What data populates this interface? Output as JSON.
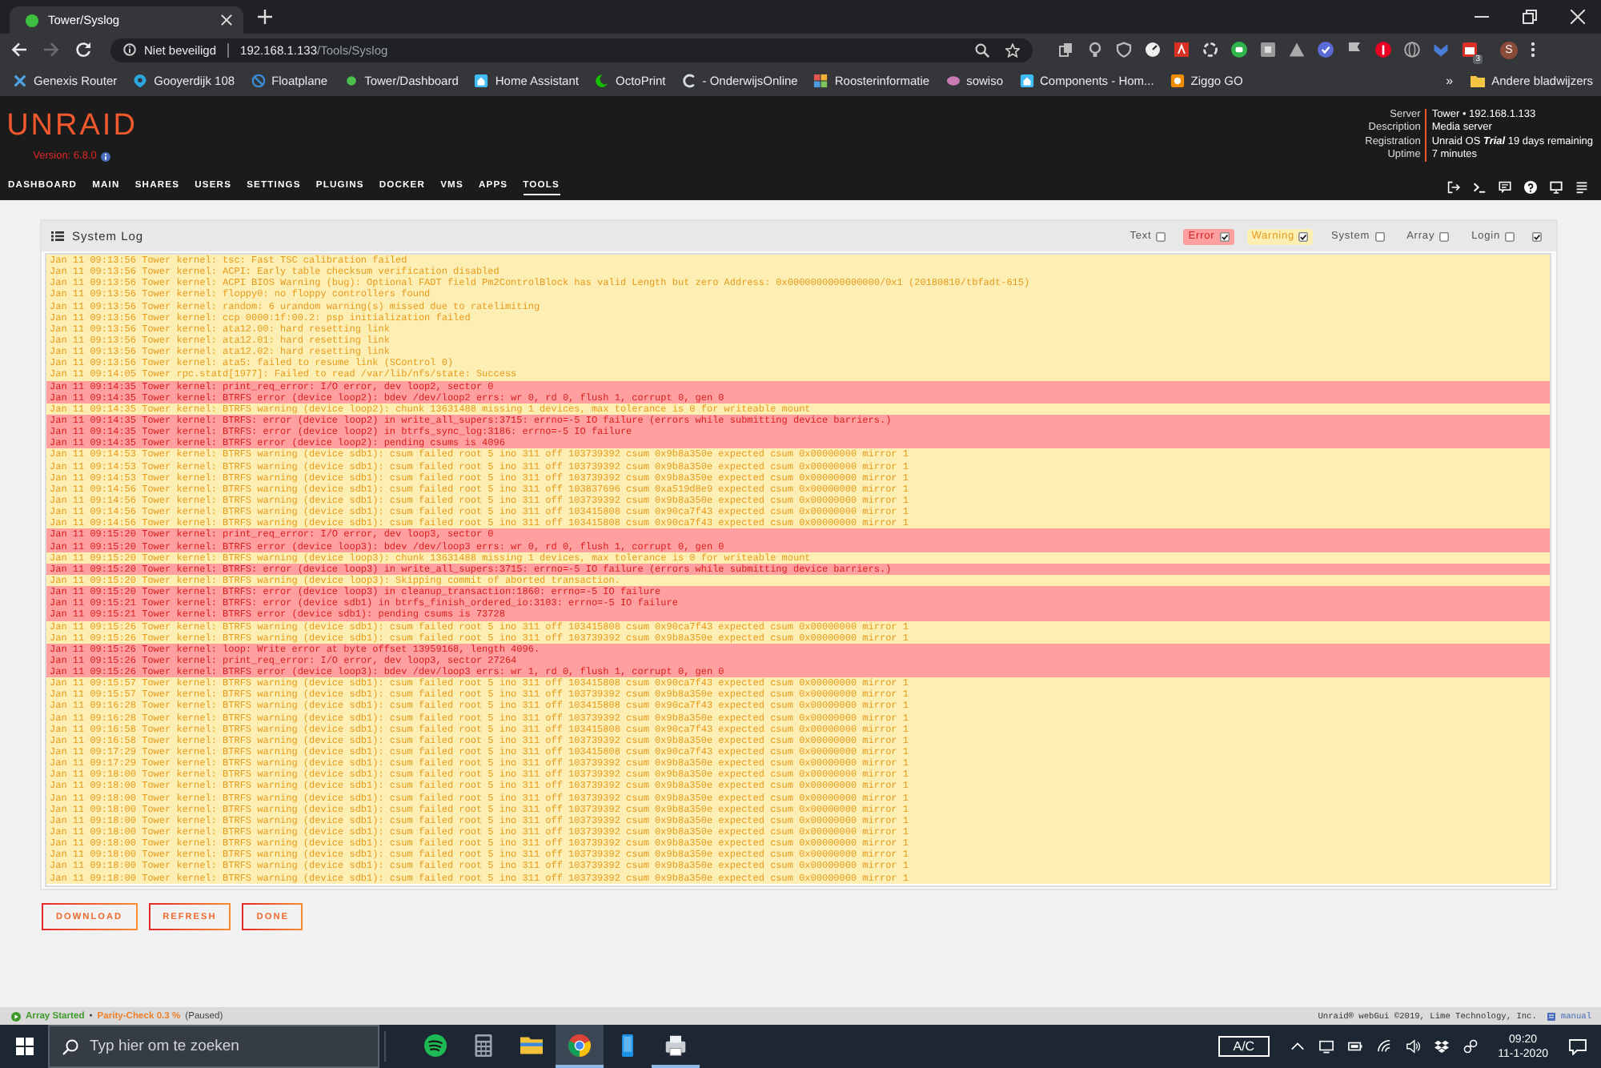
{
  "browser": {
    "tab_title": "Tower/Syslog",
    "nav": [
      {
        "kind": "back",
        "disabled": false
      },
      {
        "kind": "forward",
        "disabled": true
      },
      {
        "kind": "reload",
        "disabled": false
      }
    ],
    "address": {
      "security": "Niet beveiligd",
      "host": "192.168.1.133",
      "path": "/Tools/Syslog"
    },
    "extension_badge": "3",
    "profile_initial": "S",
    "bookmarks": [
      "Genexis Router",
      "Gooyerdijk 108",
      "Floatplane",
      "Tower/Dashboard",
      "Home Assistant",
      "OctoPrint",
      "- OnderwijsOnline",
      "Roosterinformatie",
      "sowiso",
      "Components - Hom...",
      "Ziggo GO"
    ],
    "bookmarks_overflow": "»",
    "other_bookmarks": "Andere bladwijzers"
  },
  "unraid": {
    "logo": "UNRAID",
    "version": "Version: 6.8.0",
    "server_info": [
      {
        "label": "Server",
        "value": "Tower • 192.168.1.133"
      },
      {
        "label": "Description",
        "value": "Media server"
      },
      {
        "label": "Registration",
        "value": "Unraid OS **Trial** 19 days remaining"
      },
      {
        "label": "Uptime",
        "value": "7 minutes"
      }
    ],
    "nav": [
      {
        "label": "DASHBOARD",
        "selected": false
      },
      {
        "label": "MAIN",
        "selected": false
      },
      {
        "label": "SHARES",
        "selected": false
      },
      {
        "label": "USERS",
        "selected": false
      },
      {
        "label": "SETTINGS",
        "selected": false
      },
      {
        "label": "PLUGINS",
        "selected": false
      },
      {
        "label": "DOCKER",
        "selected": false
      },
      {
        "label": "VMS",
        "selected": false
      },
      {
        "label": "APPS",
        "selected": false
      },
      {
        "label": "TOOLS",
        "selected": true
      }
    ]
  },
  "syslog": {
    "title": "System Log",
    "filters": [
      {
        "label": "Text",
        "checked": false
      },
      {
        "label": "Error",
        "checked": true,
        "color": "#ff9f9f"
      },
      {
        "label": "Warning",
        "checked": true,
        "color": "#fdefb3"
      },
      {
        "label": "System",
        "checked": false
      },
      {
        "label": "Array",
        "checked": false
      },
      {
        "label": "Login",
        "checked": false
      },
      {
        "checked": true
      }
    ],
    "lines": [
      {
        "kind": "warning",
        "text": "Jan 11 09:13:56 Tower kernel: tsc: Fast TSC calibration failed"
      },
      {
        "kind": "warning",
        "text": "Jan 11 09:13:56 Tower kernel: ACPI: Early table checksum verification disabled"
      },
      {
        "kind": "warning",
        "text": "Jan 11 09:13:56 Tower kernel: ACPI BIOS Warning (bug): Optional FADT field Pm2ControlBlock has valid Length but zero Address: 0x0000000000000000/0x1 (20180810/tbfadt-615)"
      },
      {
        "kind": "warning",
        "text": "Jan 11 09:13:56 Tower kernel: floppy0: no floppy controllers found"
      },
      {
        "kind": "warning",
        "text": "Jan 11 09:13:56 Tower kernel: random: 6 urandom warning(s) missed due to ratelimiting"
      },
      {
        "kind": "warning",
        "text": "Jan 11 09:13:56 Tower kernel: ccp 0000:1f:00.2: psp initialization failed"
      },
      {
        "kind": "warning",
        "text": "Jan 11 09:13:56 Tower kernel: ata12.00: hard resetting link"
      },
      {
        "kind": "warning",
        "text": "Jan 11 09:13:56 Tower kernel: ata12.01: hard resetting link"
      },
      {
        "kind": "warning",
        "text": "Jan 11 09:13:56 Tower kernel: ata12.02: hard resetting link"
      },
      {
        "kind": "warning",
        "text": "Jan 11 09:13:56 Tower kernel: ata5: failed to resume link (SControl 0)"
      },
      {
        "kind": "warning",
        "text": "Jan 11 09:14:05 Tower rpc.statd[1977]: Failed to read /var/lib/nfs/state: Success"
      },
      {
        "kind": "error",
        "text": "Jan 11 09:14:35 Tower kernel: print_req_error: I/O error, dev loop2, sector 0"
      },
      {
        "kind": "error",
        "text": "Jan 11 09:14:35 Tower kernel: BTRFS error (device loop2): bdev /dev/loop2 errs: wr 0, rd 0, flush 1, corrupt 0, gen 0"
      },
      {
        "kind": "warning",
        "text": "Jan 11 09:14:35 Tower kernel: BTRFS warning (device loop2): chunk 13631488 missing 1 devices, max tolerance is 0 for writeable mount"
      },
      {
        "kind": "error",
        "text": "Jan 11 09:14:35 Tower kernel: BTRFS: error (device loop2) in write_all_supers:3715: errno=-5 IO failure (errors while submitting device barriers.)"
      },
      {
        "kind": "error",
        "text": "Jan 11 09:14:35 Tower kernel: BTRFS: error (device loop2) in btrfs_sync_log:3186: errno=-5 IO failure"
      },
      {
        "kind": "error",
        "text": "Jan 11 09:14:35 Tower kernel: BTRFS error (device loop2): pending csums is 4096"
      },
      {
        "kind": "warning",
        "text": "Jan 11 09:14:53 Tower kernel: BTRFS warning (device sdb1): csum failed root 5 ino 311 off 103739392 csum 0x9b8a350e expected csum 0x00000000 mirror 1"
      },
      {
        "kind": "warning",
        "text": "Jan 11 09:14:53 Tower kernel: BTRFS warning (device sdb1): csum failed root 5 ino 311 off 103739392 csum 0x9b8a350e expected csum 0x00000000 mirror 1"
      },
      {
        "kind": "warning",
        "text": "Jan 11 09:14:53 Tower kernel: BTRFS warning (device sdb1): csum failed root 5 ino 311 off 103739392 csum 0x9b8a350e expected csum 0x00000000 mirror 1"
      },
      {
        "kind": "warning",
        "text": "Jan 11 09:14:56 Tower kernel: BTRFS warning (device sdb1): csum failed root 5 ino 311 off 103837696 csum 0xa519d8e9 expected csum 0x00000000 mirror 1"
      },
      {
        "kind": "warning",
        "text": "Jan 11 09:14:56 Tower kernel: BTRFS warning (device sdb1): csum failed root 5 ino 311 off 103739392 csum 0x9b8a350e expected csum 0x00000000 mirror 1"
      },
      {
        "kind": "warning",
        "text": "Jan 11 09:14:56 Tower kernel: BTRFS warning (device sdb1): csum failed root 5 ino 311 off 103415808 csum 0x90ca7f43 expected csum 0x00000000 mirror 1"
      },
      {
        "kind": "warning",
        "text": "Jan 11 09:14:56 Tower kernel: BTRFS warning (device sdb1): csum failed root 5 ino 311 off 103415808 csum 0x90ca7f43 expected csum 0x00000000 mirror 1"
      },
      {
        "kind": "error",
        "text": "Jan 11 09:15:20 Tower kernel: print_req_error: I/O error, dev loop3, sector 0"
      },
      {
        "kind": "error",
        "text": "Jan 11 09:15:20 Tower kernel: BTRFS error (device loop3): bdev /dev/loop3 errs: wr 0, rd 0, flush 1, corrupt 0, gen 0"
      },
      {
        "kind": "warning",
        "text": "Jan 11 09:15:20 Tower kernel: BTRFS warning (device loop3): chunk 13631488 missing 1 devices, max tolerance is 0 for writeable mount"
      },
      {
        "kind": "error",
        "text": "Jan 11 09:15:20 Tower kernel: BTRFS: error (device loop3) in write_all_supers:3715: errno=-5 IO failure (errors while submitting device barriers.)"
      },
      {
        "kind": "warning",
        "text": "Jan 11 09:15:20 Tower kernel: BTRFS warning (device loop3): Skipping commit of aborted transaction."
      },
      {
        "kind": "error",
        "text": "Jan 11 09:15:20 Tower kernel: BTRFS: error (device loop3) in cleanup_transaction:1860: errno=-5 IO failure"
      },
      {
        "kind": "error",
        "text": "Jan 11 09:15:21 Tower kernel: BTRFS: error (device sdb1) in btrfs_finish_ordered_io:3103: errno=-5 IO failure"
      },
      {
        "kind": "error",
        "text": "Jan 11 09:15:21 Tower kernel: BTRFS error (device sdb1): pending csums is 73728"
      },
      {
        "kind": "warning",
        "text": "Jan 11 09:15:26 Tower kernel: BTRFS warning (device sdb1): csum failed root 5 ino 311 off 103415808 csum 0x90ca7f43 expected csum 0x00000000 mirror 1"
      },
      {
        "kind": "warning",
        "text": "Jan 11 09:15:26 Tower kernel: BTRFS warning (device sdb1): csum failed root 5 ino 311 off 103739392 csum 0x9b8a350e expected csum 0x00000000 mirror 1"
      },
      {
        "kind": "error",
        "text": "Jan 11 09:15:26 Tower kernel: loop: Write error at byte offset 13959168, length 4096."
      },
      {
        "kind": "error",
        "text": "Jan 11 09:15:26 Tower kernel: print_req_error: I/O error, dev loop3, sector 27264"
      },
      {
        "kind": "error",
        "text": "Jan 11 09:15:26 Tower kernel: BTRFS error (device loop3): bdev /dev/loop3 errs: wr 1, rd 0, flush 1, corrupt 0, gen 0"
      },
      {
        "kind": "warning",
        "text": "Jan 11 09:15:57 Tower kernel: BTRFS warning (device sdb1): csum failed root 5 ino 311 off 103415808 csum 0x90ca7f43 expected csum 0x00000000 mirror 1"
      },
      {
        "kind": "warning",
        "text": "Jan 11 09:15:57 Tower kernel: BTRFS warning (device sdb1): csum failed root 5 ino 311 off 103739392 csum 0x9b8a350e expected csum 0x00000000 mirror 1"
      },
      {
        "kind": "warning",
        "text": "Jan 11 09:16:28 Tower kernel: BTRFS warning (device sdb1): csum failed root 5 ino 311 off 103415808 csum 0x90ca7f43 expected csum 0x00000000 mirror 1"
      },
      {
        "kind": "warning",
        "text": "Jan 11 09:16:28 Tower kernel: BTRFS warning (device sdb1): csum failed root 5 ino 311 off 103739392 csum 0x9b8a350e expected csum 0x00000000 mirror 1"
      },
      {
        "kind": "warning",
        "text": "Jan 11 09:16:58 Tower kernel: BTRFS warning (device sdb1): csum failed root 5 ino 311 off 103415808 csum 0x90ca7f43 expected csum 0x00000000 mirror 1"
      },
      {
        "kind": "warning",
        "text": "Jan 11 09:16:58 Tower kernel: BTRFS warning (device sdb1): csum failed root 5 ino 311 off 103739392 csum 0x9b8a350e expected csum 0x00000000 mirror 1"
      },
      {
        "kind": "warning",
        "text": "Jan 11 09:17:29 Tower kernel: BTRFS warning (device sdb1): csum failed root 5 ino 311 off 103415808 csum 0x90ca7f43 expected csum 0x00000000 mirror 1"
      },
      {
        "kind": "warning",
        "text": "Jan 11 09:17:29 Tower kernel: BTRFS warning (device sdb1): csum failed root 5 ino 311 off 103739392 csum 0x9b8a350e expected csum 0x00000000 mirror 1"
      },
      {
        "kind": "warning",
        "text": "Jan 11 09:18:00 Tower kernel: BTRFS warning (device sdb1): csum failed root 5 ino 311 off 103739392 csum 0x9b8a350e expected csum 0x00000000 mirror 1"
      },
      {
        "kind": "warning",
        "text": "Jan 11 09:18:00 Tower kernel: BTRFS warning (device sdb1): csum failed root 5 ino 311 off 103739392 csum 0x9b8a350e expected csum 0x00000000 mirror 1"
      },
      {
        "kind": "warning",
        "text": "Jan 11 09:18:00 Tower kernel: BTRFS warning (device sdb1): csum failed root 5 ino 311 off 103739392 csum 0x9b8a350e expected csum 0x00000000 mirror 1"
      },
      {
        "kind": "warning",
        "text": "Jan 11 09:18:00 Tower kernel: BTRFS warning (device sdb1): csum failed root 5 ino 311 off 103739392 csum 0x9b8a350e expected csum 0x00000000 mirror 1"
      },
      {
        "kind": "warning",
        "text": "Jan 11 09:18:00 Tower kernel: BTRFS warning (device sdb1): csum failed root 5 ino 311 off 103739392 csum 0x9b8a350e expected csum 0x00000000 mirror 1"
      },
      {
        "kind": "warning",
        "text": "Jan 11 09:18:00 Tower kernel: BTRFS warning (device sdb1): csum failed root 5 ino 311 off 103739392 csum 0x9b8a350e expected csum 0x00000000 mirror 1"
      },
      {
        "kind": "warning",
        "text": "Jan 11 09:18:00 Tower kernel: BTRFS warning (device sdb1): csum failed root 5 ino 311 off 103739392 csum 0x9b8a350e expected csum 0x00000000 mirror 1"
      },
      {
        "kind": "warning",
        "text": "Jan 11 09:18:00 Tower kernel: BTRFS warning (device sdb1): csum failed root 5 ino 311 off 103739392 csum 0x9b8a350e expected csum 0x00000000 mirror 1"
      },
      {
        "kind": "warning",
        "text": "Jan 11 09:18:00 Tower kernel: BTRFS warning (device sdb1): csum failed root 5 ino 311 off 103739392 csum 0x9b8a350e expected csum 0x00000000 mirror 1"
      },
      {
        "kind": "warning",
        "text": "Jan 11 09:18:00 Tower kernel: BTRFS warning (device sdb1): csum failed root 5 ino 311 off 103739392 csum 0x9b8a350e expected csum 0x00000000 mirror 1"
      }
    ],
    "buttons": [
      "DOWNLOAD",
      "REFRESH",
      "DONE"
    ]
  },
  "status_bar": {
    "array_status": "Array Started",
    "separator": "•",
    "parity": "Parity-Check 0.3 %",
    "parity_state": "(Paused)",
    "copyright": "Unraid® webGui ©2019, Lime Technology, Inc.",
    "manual": "manual"
  },
  "taskbar": {
    "search_placeholder": "Typ hier om te zoeken",
    "apps": [
      {
        "selected": false,
        "running": false
      },
      {
        "selected": false,
        "running": false
      },
      {
        "selected": false,
        "running": false
      },
      {
        "selected": true,
        "running": true
      },
      {
        "selected": false,
        "running": false
      },
      {
        "selected": false,
        "running": true
      }
    ],
    "input_indicator": "A/C",
    "clock": {
      "time": "09:20",
      "date": "11-1-2020"
    }
  }
}
